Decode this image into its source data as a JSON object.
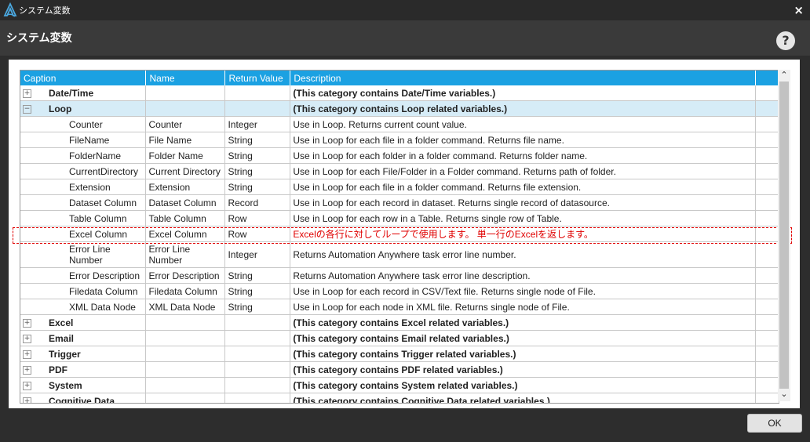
{
  "window": {
    "title": "システム変数",
    "close_glyph": "×"
  },
  "header": {
    "title": "システム変数",
    "help_glyph": "?"
  },
  "table": {
    "columns": [
      "Caption",
      "Name",
      "Return Value",
      "Description"
    ],
    "rows": [
      {
        "type": "category",
        "expander": "+",
        "caption": "Date/Time",
        "name": "",
        "ret": "",
        "desc": "(This category contains Date/Time variables.)"
      },
      {
        "type": "category",
        "expander": "−",
        "caption": "Loop",
        "name": "",
        "ret": "",
        "desc": "(This category contains Loop related variables.)",
        "selected": true
      },
      {
        "type": "item",
        "caption": "Counter",
        "name": "Counter",
        "ret": "Integer",
        "desc": "Use in Loop. Returns current count value."
      },
      {
        "type": "item",
        "caption": "FileName",
        "name": "File Name",
        "ret": "String",
        "desc": "Use in Loop for each file in a folder command. Returns file name."
      },
      {
        "type": "item",
        "caption": "FolderName",
        "name": "Folder Name",
        "ret": "String",
        "desc": "Use in Loop for each folder in a folder command. Returns folder name."
      },
      {
        "type": "item",
        "caption": "CurrentDirectory",
        "name": "Current Directory",
        "ret": "String",
        "desc": "Use in Loop for each File/Folder in a Folder command. Returns path of folder."
      },
      {
        "type": "item",
        "caption": "Extension",
        "name": "Extension",
        "ret": "String",
        "desc": "Use in Loop for each file in a folder command. Returns file extension."
      },
      {
        "type": "item",
        "caption": "Dataset Column",
        "name": "Dataset Column",
        "ret": "Record",
        "desc": "Use in Loop for each record in dataset. Returns single record of datasource."
      },
      {
        "type": "item",
        "caption": "Table Column",
        "name": "Table Column",
        "ret": "Row",
        "desc": "Use in Loop for each row in a Table. Returns single row of Table."
      },
      {
        "type": "item",
        "caption": "Excel Column",
        "name": "Excel Column",
        "ret": "Row",
        "desc": "Excelの各行に対してループで使用します。 単一行のExcelを返します。",
        "red": true
      },
      {
        "type": "item",
        "tall": true,
        "caption": "Error Line Number",
        "name": "Error Line Number",
        "ret": "Integer",
        "desc": "Returns Automation Anywhere task error line number."
      },
      {
        "type": "item",
        "caption": "Error Description",
        "name": "Error Description",
        "ret": "String",
        "desc": "Returns Automation Anywhere task error line description."
      },
      {
        "type": "item",
        "caption": "Filedata Column",
        "name": "Filedata Column",
        "ret": "String",
        "desc": "Use in Loop for each record in CSV/Text file. Returns single node of File."
      },
      {
        "type": "item",
        "caption": "XML Data Node",
        "name": "XML Data Node",
        "ret": "String",
        "desc": "Use in Loop for each node in XML file. Returns single node of File."
      },
      {
        "type": "category",
        "expander": "+",
        "caption": "Excel",
        "name": "",
        "ret": "",
        "desc": "(This category contains Excel related variables.)"
      },
      {
        "type": "category",
        "expander": "+",
        "caption": "Email",
        "name": "",
        "ret": "",
        "desc": "(This category contains Email related variables.)"
      },
      {
        "type": "category",
        "expander": "+",
        "caption": "Trigger",
        "name": "",
        "ret": "",
        "desc": "(This category contains Trigger related variables.)"
      },
      {
        "type": "category",
        "expander": "+",
        "caption": "PDF",
        "name": "",
        "ret": "",
        "desc": "(This category contains PDF related variables.)"
      },
      {
        "type": "category",
        "expander": "+",
        "caption": "System",
        "name": "",
        "ret": "",
        "desc": "(This category contains System related variables.)"
      },
      {
        "type": "category",
        "expander": "+",
        "caption": "Cognitive Data",
        "name": "",
        "ret": "",
        "desc": "(This category contains Cognitive Data related variables.)"
      }
    ]
  },
  "scrollbar": {
    "up_glyph": "⌃",
    "down_glyph": "⌄"
  },
  "footer": {
    "ok_label": "OK"
  },
  "colors": {
    "header_blue": "#1ba1e2",
    "selected_row": "#d6ecf7",
    "annotation_red": "#e00000"
  }
}
